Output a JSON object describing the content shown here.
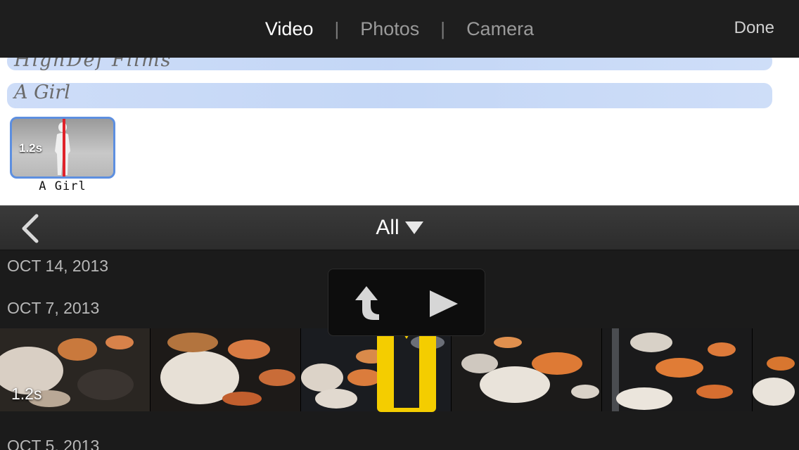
{
  "header": {
    "tabs": [
      {
        "label": "Video",
        "active": true
      },
      {
        "label": "Photos",
        "active": false
      },
      {
        "label": "Camera",
        "active": false
      }
    ],
    "separator": "|",
    "done_label": "Done"
  },
  "storyboard": {
    "title_scribble": "HighDef Films",
    "subtitle_scribble": "A Girl",
    "clip": {
      "duration": "1.2s",
      "label": "A Girl"
    }
  },
  "browser": {
    "filter_label": "All",
    "back_icon": "chevron-left-icon",
    "filter_icon": "triangle-down-icon",
    "dates": [
      "OCT 14, 2013",
      "OCT 7, 2013",
      "OCT 5, 2013"
    ],
    "video_strip": {
      "duration": "1.2s"
    },
    "popover": {
      "icons": [
        "insert-arrow-icon",
        "play-icon"
      ]
    }
  },
  "colors": {
    "selection": "#f4cd00",
    "clip_border": "#5d8fe0",
    "playhead": "#e0222a",
    "paint_band": "#c8d9f7"
  }
}
